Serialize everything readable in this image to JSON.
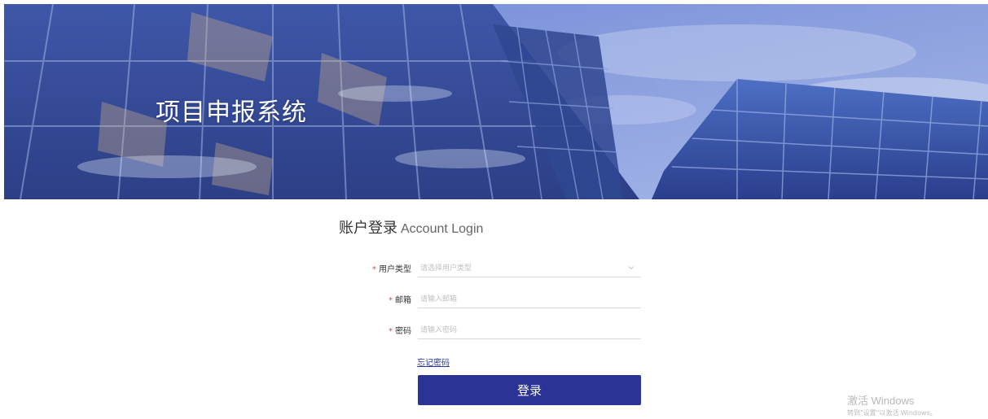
{
  "banner": {
    "title": "项目申报系统"
  },
  "login": {
    "heading_zh": "账户登录",
    "heading_en": "Account Login",
    "fields": [
      {
        "label": "用户类型",
        "required": true,
        "placeholder": "请选择用户类型",
        "type": "select",
        "value": ""
      },
      {
        "label": "邮箱",
        "required": true,
        "placeholder": "请输入邮箱",
        "type": "text",
        "value": ""
      },
      {
        "label": "密码",
        "required": true,
        "placeholder": "请输入密码",
        "type": "password",
        "value": ""
      }
    ],
    "required_mark": "*",
    "forgot_password": "忘记密码",
    "submit_label": "登录"
  },
  "watermark": {
    "line1": "激活 Windows",
    "line2": "转到\"设置\"以激活 Windows。"
  },
  "colors": {
    "primary": "#2b3494",
    "link": "#2b3a9c",
    "required": "#e8483c"
  }
}
